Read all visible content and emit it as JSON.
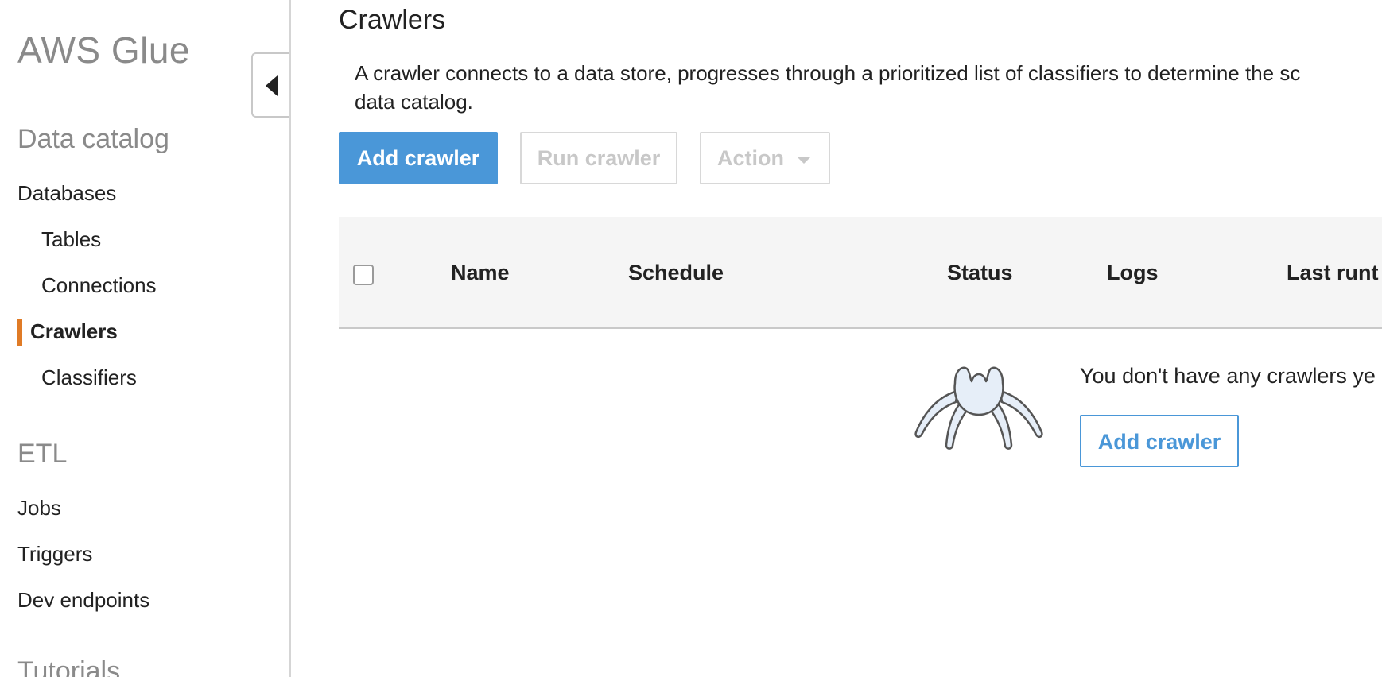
{
  "sidebar": {
    "app_title": "AWS Glue",
    "sections": {
      "data_catalog": "Data catalog",
      "etl": "ETL",
      "tutorials": "Tutorials"
    },
    "items": {
      "databases": "Databases",
      "tables": "Tables",
      "connections": "Connections",
      "crawlers": "Crawlers",
      "classifiers": "Classifiers",
      "jobs": "Jobs",
      "triggers": "Triggers",
      "dev_endpoints": "Dev endpoints"
    },
    "active_item": "Crawlers",
    "active_color": "#e07b26"
  },
  "main": {
    "title": "Crawlers",
    "description_line1": "A crawler connects to a data store, progresses through a prioritized list of classifiers to determine the sc",
    "description_line2": "data catalog.",
    "toolbar": {
      "add_label": "Add crawler",
      "run_label": "Run crawler",
      "action_label": "Action"
    },
    "table": {
      "columns": [
        "Name",
        "Schedule",
        "Status",
        "Logs",
        "Last runt"
      ]
    },
    "empty_state": {
      "message": "You don't have any crawlers ye",
      "button_label": "Add crawler",
      "icon": "spider-icon"
    }
  },
  "colors": {
    "primary": "#4a97d8",
    "disabled": "#c8c8c8",
    "header_bg": "#f5f5f5"
  }
}
